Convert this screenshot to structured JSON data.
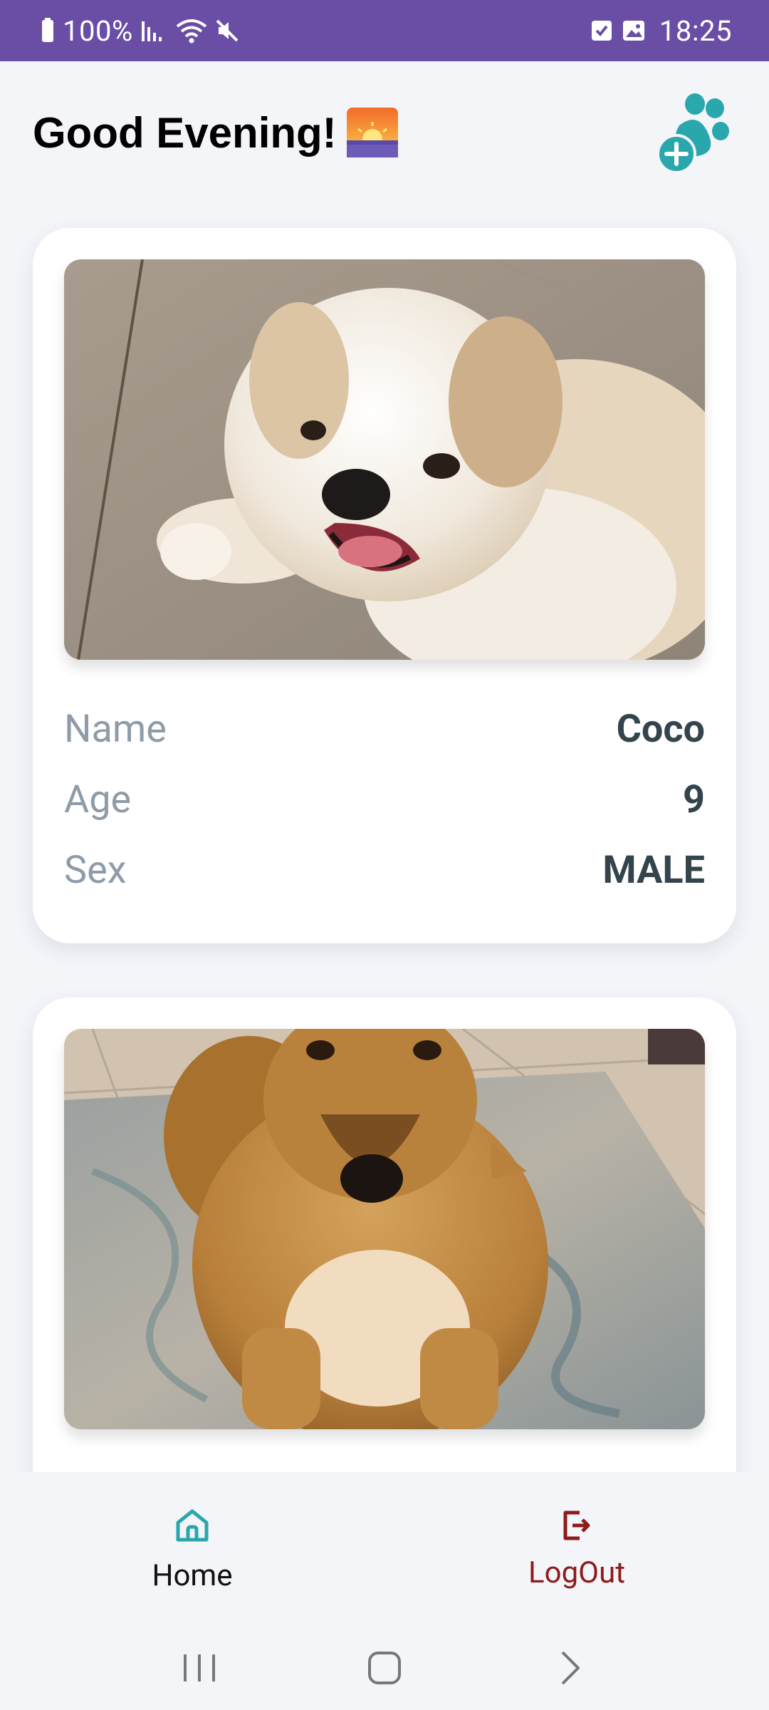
{
  "status_bar": {
    "battery": "100%",
    "time": "18:25"
  },
  "header": {
    "greeting": "Good Evening!"
  },
  "colors": {
    "status_bar": "#6a4ea6",
    "accent_teal": "#2aa7ad",
    "logout_red": "#8f1a1a",
    "label_gray": "#8e9ba8",
    "value_dark": "#34444c"
  },
  "pets": [
    {
      "image": "white-shih-tzu-photo",
      "rows": [
        {
          "label": "Name",
          "value": "Coco"
        },
        {
          "label": "Age",
          "value": "9"
        },
        {
          "label": "Sex",
          "value": "MALE"
        }
      ]
    },
    {
      "image": "tan-dog-on-rug-photo"
    }
  ],
  "bottom_nav": {
    "home": {
      "label": "Home",
      "icon": "home-icon"
    },
    "logout": {
      "label": "LogOut",
      "icon": "logout-icon"
    }
  },
  "system_nav": {
    "recents": "recents-icon",
    "home": "circle-home-icon",
    "back": "chevron-right-icon"
  }
}
